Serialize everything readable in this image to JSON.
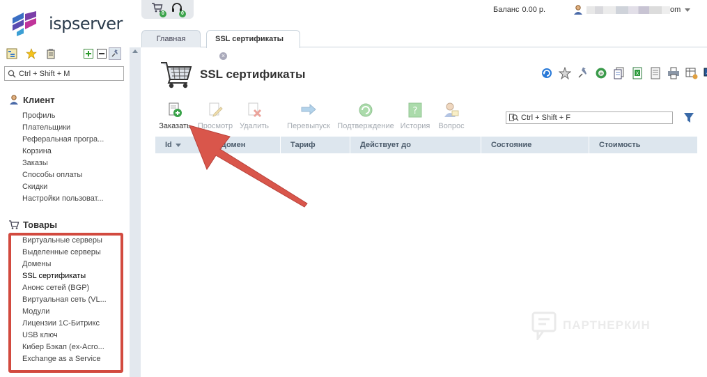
{
  "brand": {
    "logo_text": "ispserver"
  },
  "sidebar": {
    "search_placeholder": "Ctrl + Shift + M",
    "sections": [
      {
        "title": "Клиент",
        "icon": "user-icon",
        "items": [
          "Профиль",
          "Плательщики",
          "Реферальная програ...",
          "Корзина",
          "Заказы",
          "Способы оплаты",
          "Скидки",
          "Настройки пользоват..."
        ]
      },
      {
        "title": "Товары",
        "icon": "cart-icon",
        "items": [
          "Виртуальные серверы",
          "Выделенные серверы",
          "Домены",
          "SSL сертификаты",
          "Анонс сетей (BGP)",
          "Виртуальная сеть (VL...",
          "Модули",
          "Лицензии 1С-Битрикс",
          "USB ключ",
          "Кибер Бэкап (ex-Acro...",
          "Exchange as a Service"
        ],
        "active_index": 3
      }
    ]
  },
  "top": {
    "cart_badge": "0",
    "support_badge": "0",
    "balance_label": "Баланс",
    "balance_value": "0.00 р.",
    "user_suffix": "om"
  },
  "tabs": [
    {
      "label": "Главная"
    },
    {
      "label": "SSL сертификаты",
      "close": "×"
    }
  ],
  "page": {
    "title": "SSL сертификаты",
    "filter_placeholder": "Ctrl + Shift + F"
  },
  "toolbar": [
    {
      "label": "Заказать",
      "enabled": true,
      "icon": "add-order-icon"
    },
    {
      "label": "Просмотр",
      "enabled": false,
      "icon": "edit-icon"
    },
    {
      "label": "Удалить",
      "enabled": false,
      "icon": "delete-icon"
    },
    {
      "label": "Перевыпуск",
      "enabled": false,
      "icon": "reissue-icon"
    },
    {
      "label": "Подтверждение",
      "enabled": false,
      "icon": "confirm-icon"
    },
    {
      "label": "История",
      "enabled": false,
      "icon": "history-icon"
    },
    {
      "label": "Вопрос",
      "enabled": false,
      "icon": "question-icon"
    }
  ],
  "table": {
    "columns": [
      "Id",
      "Домен",
      "Тариф",
      "Действует до",
      "Состояние",
      "Стоимость"
    ]
  },
  "watermark": "ПАРТНЕРКИН",
  "colors": {
    "highlight": "#d24a3f",
    "arrow": "#d9564b",
    "table_header": "#dde6ee"
  }
}
